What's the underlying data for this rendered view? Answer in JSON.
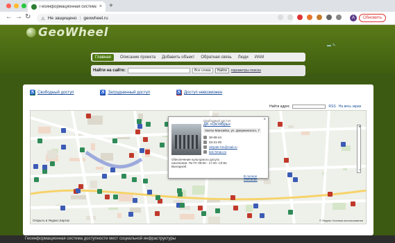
{
  "browser": {
    "tab_title": "Геоинформационная системa",
    "new_tab": "+",
    "url_security": "Не защищено",
    "url_separator": "|",
    "url": "geowheel.ru",
    "update_label": "Обновить",
    "avatar_letter": "A"
  },
  "site": {
    "logo_text": "GeoWheel",
    "menu": [
      {
        "label": "Главная"
      },
      {
        "label": "Описание проекта"
      },
      {
        "label": "Добавить объект"
      },
      {
        "label": "Обратная связь"
      },
      {
        "label": "Люди"
      },
      {
        "label": "ИАМ"
      }
    ],
    "search_label": "Найти на сайте:",
    "search_scope": "Все слова",
    "search_button": "Найти",
    "search_params": "параметры поиска"
  },
  "legend": [
    {
      "label": "Свободный доступ",
      "color": "#2e8b57"
    },
    {
      "label": "Затрудненный доступ",
      "color": "#3b5bb5"
    },
    {
      "label": "Доступ невозможен",
      "color": "#c0392b"
    }
  ],
  "map": {
    "address_label": "Найти адрес",
    "rss": "RSS",
    "full_screen": "На весь экран",
    "open_yandex": "Открыть в Яндекс.Картах",
    "copyright": "© Яндекс Условия использования",
    "zoom_in": "+",
    "zoom_out": "−"
  },
  "popup": {
    "category": "Свободный доступ",
    "name": "ДК «Октябрь»",
    "address": "Ханты-Мансийск, ул. Дзержинского, 7",
    "phone": "30-09-24",
    "hours": "33-21-00",
    "email": "oktyabr-hm@mail.ru",
    "site": "kdc-hmao.ru",
    "description": "Обеспечение культурного досуга населения. Пн-Пт 09:00 - 17:30. Сб-Вс Выходной.",
    "more": "В полное описание",
    "close": "×"
  },
  "footer": "Геоинформационная система доступности мест социальной инфраструктуры"
}
